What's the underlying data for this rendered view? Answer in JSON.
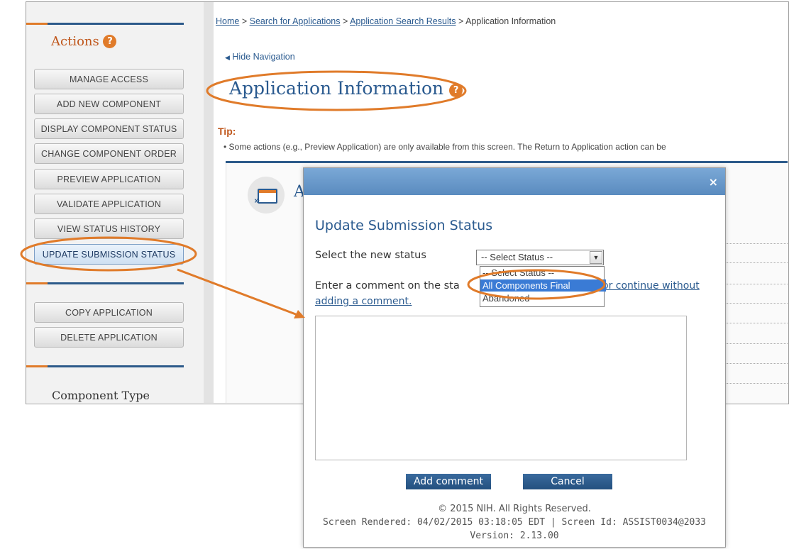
{
  "sidebar": {
    "actions_title": "Actions",
    "help_icon": "?",
    "buttons": [
      "MANAGE ACCESS",
      "ADD NEW COMPONENT",
      "DISPLAY COMPONENT STATUS",
      "CHANGE COMPONENT ORDER",
      "PREVIEW APPLICATION",
      "VALIDATE APPLICATION",
      "VIEW STATUS HISTORY",
      "UPDATE SUBMISSION STATUS"
    ],
    "buttons2": [
      "COPY APPLICATION",
      "DELETE APPLICATION"
    ],
    "component_type": "Component Type"
  },
  "breadcrumb": {
    "items": [
      "Home",
      "Search for Applications",
      "Application Search Results"
    ],
    "separator": ">",
    "current": "Application Information"
  },
  "nav": {
    "hide_navigation": "Hide Navigation"
  },
  "page": {
    "title": "Application Information",
    "tip_label": "Tip:",
    "tip_text": "Some actions (e.g., Preview Application) are only available from this screen. The Return to Application action can be",
    "heading_fragment": "A"
  },
  "modal": {
    "title": "Update Submission Status",
    "close": "×",
    "status_label": "Select the new status",
    "select_value": "-- Select Status --",
    "options": [
      "-- Select Status --",
      "All Components Final",
      "Abandoned"
    ],
    "selected_option": "All Components Final",
    "comment_label": "Enter a comment on the sta",
    "continue_link_part1": "or continue without",
    "continue_link_part2": "adding a comment.",
    "add_comment": "Add comment",
    "cancel": "Cancel",
    "footer_copyright": "© 2015 NIH. All Rights Reserved.",
    "footer_rendered": "Screen Rendered: 04/02/2015 03:18:05 EDT | Screen Id: ASSIST0034@2033",
    "footer_version": "Version: 2.13.00"
  },
  "colors": {
    "accent": "#e07b2a",
    "link": "#2a5a8f",
    "highlight": "#3a7bd5"
  }
}
